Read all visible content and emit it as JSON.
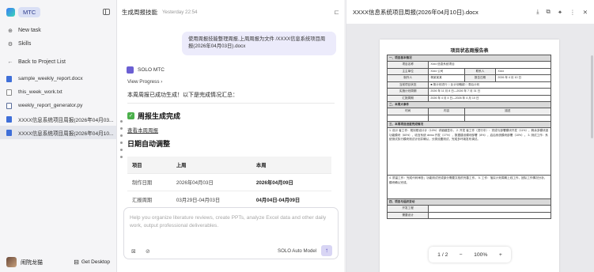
{
  "app": {
    "name": "MTC"
  },
  "sidebar": {
    "new_task": "New task",
    "skills": "Skills",
    "back": "Back to Project List",
    "files": [
      {
        "name": "sample_weekly_report.docx",
        "type": "doc"
      },
      {
        "name": "this_week_work.txt",
        "type": "md"
      },
      {
        "name": "weekly_report_generator.py",
        "type": "py"
      },
      {
        "name": "XXXX信息系统项目周报(2026年04月03...",
        "type": "doc"
      },
      {
        "name": "XXXX信息系统项目周报(2026年04月10...",
        "type": "doc"
      }
    ],
    "user": "闹院龙猫",
    "get_desktop": "Get Desktop"
  },
  "chat": {
    "title": "生成周报技能",
    "time": "Yesterday 22:54",
    "user_message": "使用周报技能整理周报,上周周报为文件 /XXXX信息系统项目周报(2026年04月03日).docx",
    "assistant_name": "SOLO MTC",
    "view_progress": "View Progress",
    "summary": "本周周报已成功生成！以下是完成情况汇总：",
    "done_heading": "周报生成完成",
    "view_link": "查看本周周报",
    "auto_heading": "日期自动调整",
    "table": {
      "headers": [
        "项目",
        "上周",
        "本周"
      ],
      "rows": [
        [
          "制作日期",
          "2026年04月03日",
          "2026年04月09日"
        ],
        [
          "汇报周期",
          "03月29日-04月03日",
          "04月04日-04月09日"
        ]
      ]
    },
    "composer_placeholder": "Help you organize literature reviews, create PPTs, analyze Excel data and other daily work, output professional deliverables.",
    "model": "SOLO Auto Model"
  },
  "preview": {
    "title": "XXXX信息系统项目周报(2026年04月10日).docx",
    "page": "1",
    "pages": "2",
    "zoom": "100%",
    "doc": {
      "title": "项目状态周报告表",
      "s1": "一、项目基本情况",
      "name_label": "项目名称",
      "name_value": "Xxxx 信息系统项目",
      "dept_label": "主主单位",
      "dept_value": "Xxxx 公司",
      "contact_label": "联系人",
      "contact_value": "Xxxx",
      "author_label": "制作人",
      "author_value": "杨某某某",
      "date_label": "报告日期",
      "date_value": "2026 年 4 月 10 日",
      "status_label": "当前项目状态",
      "status_value": "■ 按计划进行  □ 比计划略超  □ 滞后计划",
      "plan_label": "实施计划周期",
      "plan_value": "2026 年 11 月 8 日—2026 年 7 月 31 日",
      "period_label": "汇报周期",
      "period_value": "2026 年 4 月 4 日—2026 年 4 月 10 日",
      "s2": "二、本周大事件",
      "col_time": "时间",
      "col_content": "内容",
      "col_desc": "描述",
      "s3": "三、本周项目进度完成情况",
      "progress": "1. 设计 者工作：规划框设计计（10%）详细细显中。 2. 开发 者工作（进行中）：完成与部署模块开发（11%），剩余多模块逐功能模块（60%），收言系统 demo 开发（17%），数据建设模块部署（8%），启后系统模块部署（10%）。 3. 测试工作：系统测试执行模块测试计划并确认，分类设置测试，完成多环境发布调试。",
      "issues": "4. 质量工作：完成代码审查；功能测试完成部分需要文档的完善工作。 5. 工作：落实计划周期上线工作，团队工作情况分析，模块确认完成。",
      "s4": "四、项目与组织变动",
      "row_a": "开发工程",
      "row_b": "需要设计"
    }
  }
}
